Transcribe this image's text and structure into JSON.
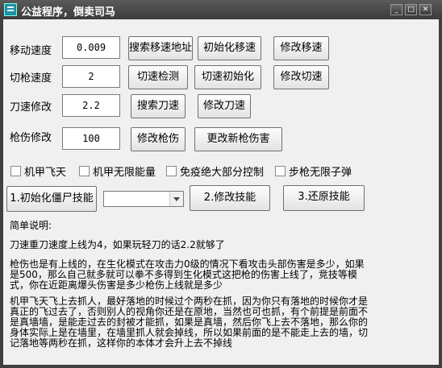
{
  "window": {
    "title": "公益程序，倒卖司马",
    "minimize": "_",
    "maximize": "□",
    "close": "✕"
  },
  "rows": [
    {
      "label": "移动速度",
      "value": "0.009",
      "buttons": [
        "搜索移速地址",
        "初始化移速",
        "修改移速"
      ]
    },
    {
      "label": "切枪速度",
      "value": "2",
      "buttons": [
        "切速检测",
        "切速初始化",
        "修改切速"
      ]
    },
    {
      "label": "刀速修改",
      "value": "2.2",
      "buttons": [
        "搜索刀速",
        "修改刀速"
      ]
    },
    {
      "label": "枪伤修改",
      "value": "100",
      "buttons": [
        "修改枪伤",
        "更改新枪伤害"
      ]
    }
  ],
  "checkboxes": [
    "机甲飞天",
    "机甲无限能量",
    "免疫绝大部分控制",
    "步枪无限子弹"
  ],
  "zombie": {
    "init_button": "1.初始化僵尸技能",
    "combo_value": "",
    "modify_button": "2.修改技能",
    "restore_button": "3.还原技能"
  },
  "notes": {
    "title": "简单说明:",
    "p1": "刀速重刀速度上线为4，如果玩轻刀的话2.2就够了",
    "p2": "枪伤也是有上线的，在生化模式在攻击力0级的情况下看攻击头部伤害是多少，如果是500，那么自己就多就可以拳不多得到生化模式这把枪的伤害上线了，竞技等模式，你在近距离爆头伤害是多少枪伤上线就是多少",
    "p3": "机甲飞天飞上去抓人，最好落地的时候过个两秒在抓，因为你只有落地的时候你才是真正的飞过去了，否则别人的视角你还是在原地，当然也可也抓，有个前提是前面不是真墙墙，是能走过去的封被才能抓，如果是真墙，然后你飞上去不落地，那么你的身体实际上是在墙里，在墙里抓人就会掉线，所以如果前面的是不能走上去的墙，切记落地等两秒在抓，这样你的本体才会升上去不掉线"
  }
}
